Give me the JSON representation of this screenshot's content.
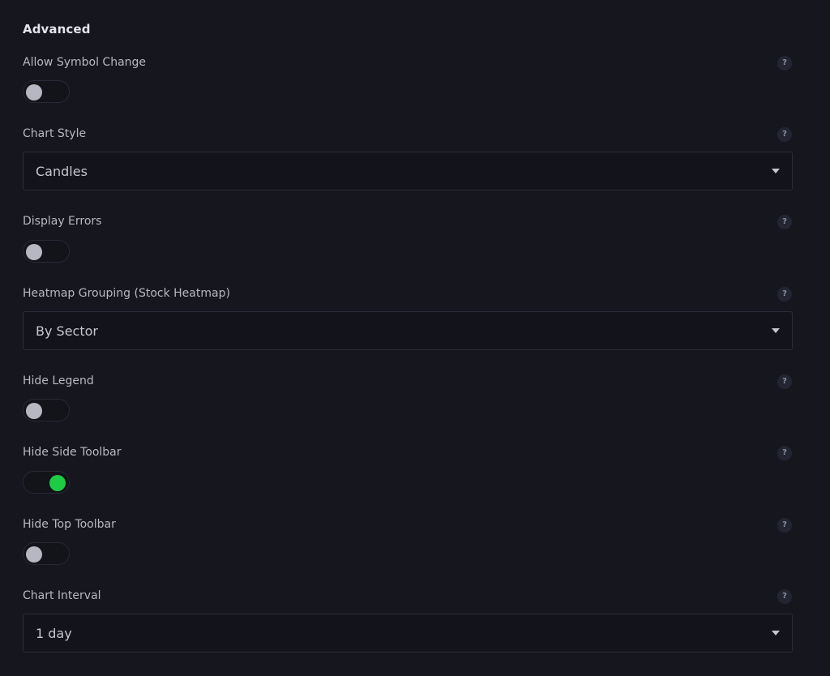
{
  "section": {
    "title": "Advanced"
  },
  "help_glyph": "?",
  "colors": {
    "background": "#16161f",
    "toggle_on": "#1ecb45",
    "toggle_off_knob": "#b7b7c2"
  },
  "settings": {
    "allow_symbol_change": {
      "label": "Allow Symbol Change",
      "enabled": false
    },
    "chart_style": {
      "label": "Chart Style",
      "value": "Candles"
    },
    "display_errors": {
      "label": "Display Errors",
      "enabled": false
    },
    "heatmap_grouping": {
      "label": "Heatmap Grouping (Stock Heatmap)",
      "value": "By Sector"
    },
    "hide_legend": {
      "label": "Hide Legend",
      "enabled": false
    },
    "hide_side_toolbar": {
      "label": "Hide Side Toolbar",
      "enabled": true
    },
    "hide_top_toolbar": {
      "label": "Hide Top Toolbar",
      "enabled": false
    },
    "chart_interval": {
      "label": "Chart Interval",
      "value": "1 day"
    }
  }
}
